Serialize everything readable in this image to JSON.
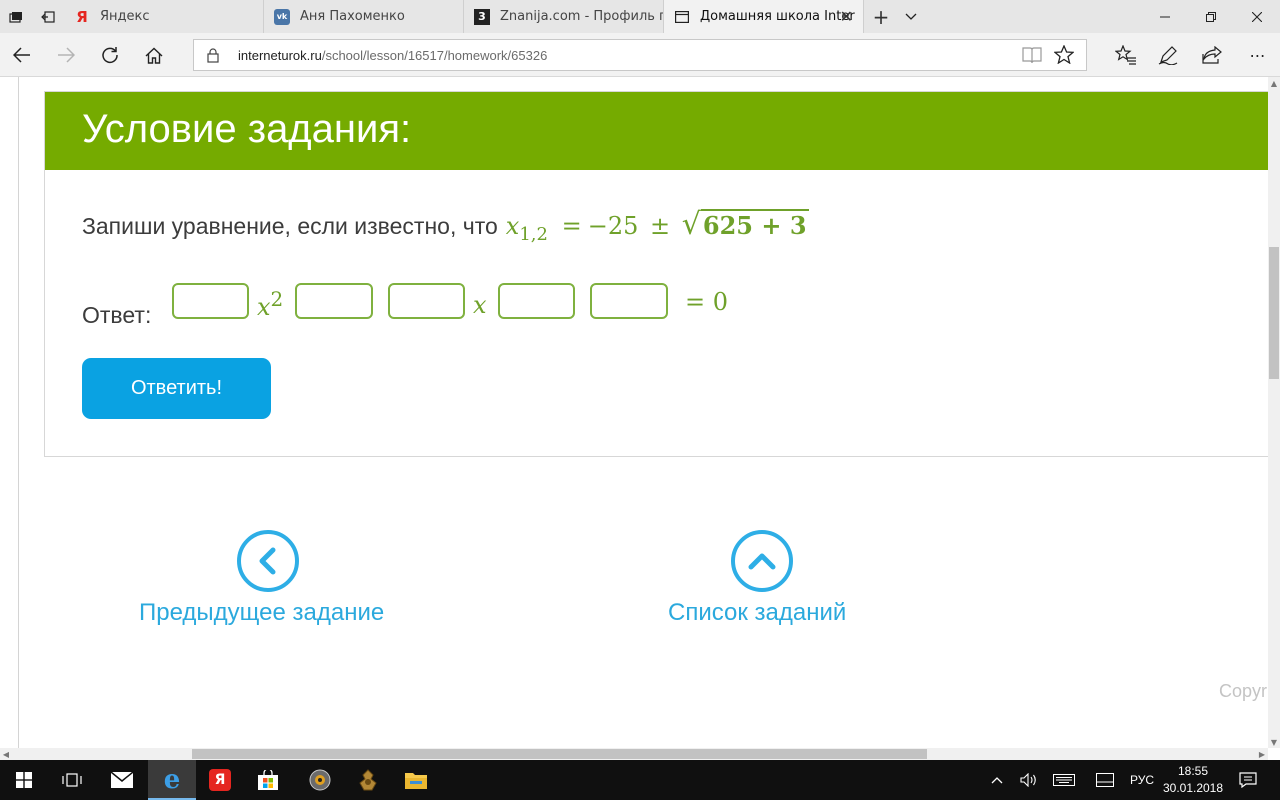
{
  "browser": {
    "tabs": [
      {
        "title": "Яндекс",
        "favicon": "yandex-icon",
        "active": false
      },
      {
        "title": "Аня Пахоменко",
        "favicon": "vk-icon",
        "active": false
      },
      {
        "title": "Znanija.com - Профиль пол",
        "favicon": "znanija-icon",
        "active": false
      },
      {
        "title": "Домашняя школа Inter",
        "favicon": "page-icon",
        "active": true
      }
    ],
    "url_host": "interneturok.ru",
    "url_path": "/school/lesson/16517/homework/65326"
  },
  "task": {
    "header": "Условие задания:",
    "question_text": "Запиши уравнение, если известно, что",
    "formula": {
      "var": "x",
      "sub": "1,2",
      "eq": "=",
      "rhs_a": "−25",
      "pm": "±",
      "sqrt_body": "625 + 3"
    },
    "answer_label": "Ответ:",
    "answer_terms": {
      "x2_var": "x",
      "x2_pow": "2",
      "x_var": "x",
      "rhs": "= 0"
    },
    "inputs": [
      "",
      "",
      "",
      "",
      ""
    ],
    "submit_label": "Ответить!"
  },
  "nav": {
    "prev_label": "Предыдущее задание",
    "list_label": "Список заданий"
  },
  "footer": {
    "copyright": "Copyr"
  },
  "taskbar": {
    "language": "РУС",
    "time": "18:55",
    "date": "30.01.2018"
  },
  "colors": {
    "header_green": "#75ab00",
    "math_green": "#6fa12a",
    "button_blue": "#0aa2e2",
    "link_blue": "#2ba9dd"
  }
}
